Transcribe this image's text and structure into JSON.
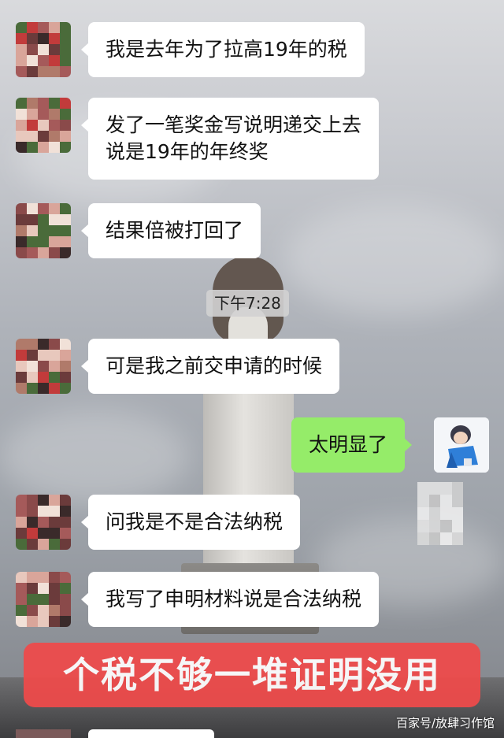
{
  "messages": [
    {
      "side": "left",
      "text": "我是去年为了拉高19年的税"
    },
    {
      "side": "left",
      "lines": [
        "发了一笔奖金写说明递交上去",
        "说是19年的年终奖"
      ]
    },
    {
      "side": "left",
      "text": "结果倍被打回了"
    },
    {
      "side": "left",
      "text": "可是我之前交申请的时候"
    },
    {
      "side": "right",
      "text": "太明显了"
    },
    {
      "side": "left",
      "text": "问我是不是合法纳税"
    },
    {
      "side": "left",
      "text": "我写了申明材料说是合法纳税"
    }
  ],
  "timestamp": "下午7:28",
  "banner": "个税不够一堆证明没用",
  "watermark": "百家号/放肆习作馆",
  "colors": {
    "bubble_left": "#ffffff",
    "bubble_right": "#95ec69",
    "banner": "#f04a4a"
  },
  "icons": {
    "left_avatar": "pixelated-avatar",
    "right_avatar": "cartoon-character-avatar"
  }
}
